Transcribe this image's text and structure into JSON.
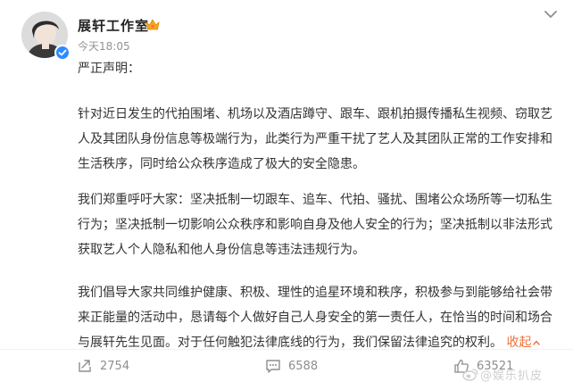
{
  "post": {
    "author": "展轩工作室",
    "time": "今天18:05",
    "greeting": "严正声明：",
    "paragraphs": [
      [
        "针对近日发生的代拍围堵、机场以及酒店蹲守、跟车、跟机拍摄传播私生视频、窃取艺",
        "人及其团队身份信息等极端行为，此类行为严重干扰了艺人及其团队正常的工作安排和",
        "生活秩序，同时给公众秩序造成了极大的安全隐患。"
      ],
      [
        "我们郑重呼吁大家：坚决抵制一切跟车、追车、代拍、骚扰、围堵公众场所等一切私生",
        "行为；坚决抵制一切影响公众秩序和影响自身及他人安全的行为；坚决抵制以非法形式",
        "获取艺人个人隐私和他人身份信息等违法违规行为。"
      ],
      [
        "我们倡导大家共同维护健康、积极、理性的追星环境和秩序，积极参与到能够给社会带",
        "来正能量的活动中，恳请每个人做好自己人身安全的第一责任人，在恰当的时间和场合",
        "与展轩先生见面。对于任何触犯法律底线的行为，我们保留法律追究的权利。"
      ]
    ],
    "collapse_label": "收起"
  },
  "actions": {
    "repost_count": "2754",
    "comment_count": "6588",
    "like_count": "63521"
  },
  "watermark": "@娱乐扒皮",
  "colors": {
    "accent": "#eb7340",
    "verified": "#2e8bff",
    "text": "#333333",
    "muted": "#8d8d8d"
  },
  "icons": {
    "more": "chevron-down-icon",
    "verified": "verified-badge-icon",
    "crown": "vip-crown-icon",
    "repost": "repost-icon",
    "comment": "comment-icon",
    "like": "like-icon",
    "watermark": "weibo-logo-icon"
  }
}
